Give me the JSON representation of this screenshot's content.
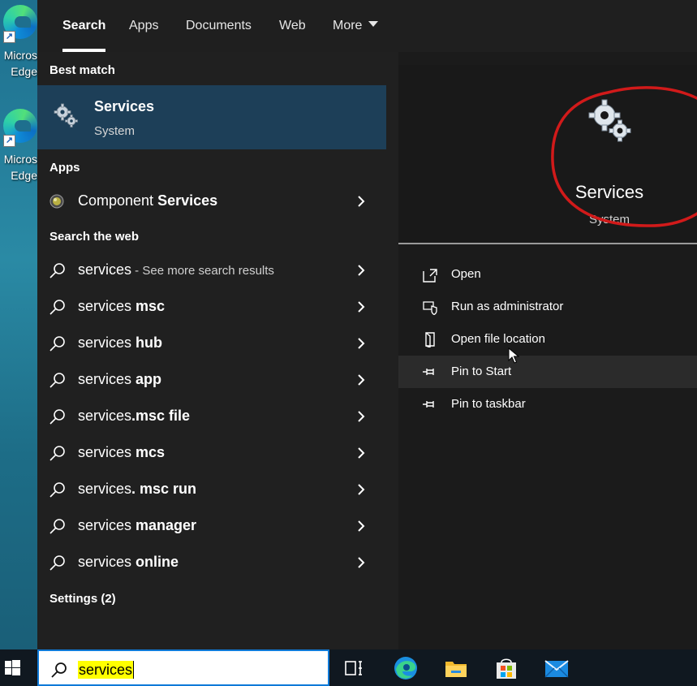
{
  "desktop": {
    "icons": [
      {
        "label": "Micros",
        "label2": "Edge",
        "icon": "edge-icon"
      },
      {
        "label": "Micros",
        "label2": "Edge",
        "icon": "edge-icon"
      }
    ]
  },
  "tabs": [
    {
      "label": "Search",
      "active": true
    },
    {
      "label": "Apps"
    },
    {
      "label": "Documents"
    },
    {
      "label": "Web"
    },
    {
      "label": "More"
    }
  ],
  "best_match": {
    "heading": "Best match",
    "title": "Services",
    "subtitle": "System",
    "icon": "gears-icon"
  },
  "apps": {
    "heading": "Apps",
    "items": [
      {
        "prefix": "Component ",
        "bold": "Services",
        "icon": "component-services-icon"
      }
    ]
  },
  "web": {
    "heading": "Search the web",
    "items": [
      {
        "prefix": "services",
        "bold": "",
        "hint": " - See more search results"
      },
      {
        "prefix": "services ",
        "bold": "msc"
      },
      {
        "prefix": "services ",
        "bold": "hub"
      },
      {
        "prefix": "services ",
        "bold": "app"
      },
      {
        "prefix": "services",
        "bold": ".msc file"
      },
      {
        "prefix": "services ",
        "bold": "mcs"
      },
      {
        "prefix": "services",
        "bold": ". msc run"
      },
      {
        "prefix": "services ",
        "bold": "manager"
      },
      {
        "prefix": "services ",
        "bold": "online"
      }
    ]
  },
  "settings": {
    "heading": "Settings (2)"
  },
  "preview": {
    "title": "Services",
    "subtitle": "System",
    "annotation_color": "#d11a1a",
    "actions": [
      {
        "label": "Open",
        "icon": "open-icon"
      },
      {
        "label": "Run as administrator",
        "icon": "shield-icon"
      },
      {
        "label": "Open file location",
        "icon": "file-location-icon"
      },
      {
        "label": "Pin to Start",
        "icon": "pin-icon",
        "highlighted": true
      },
      {
        "label": "Pin to taskbar",
        "icon": "pin-icon"
      }
    ]
  },
  "taskbar": {
    "search_value": "services",
    "search_highlight": "#ffff00",
    "accent": "#0f7ad8",
    "apps": [
      "task-view-icon",
      "edge-icon",
      "file-explorer-icon",
      "store-icon",
      "mail-icon"
    ]
  }
}
